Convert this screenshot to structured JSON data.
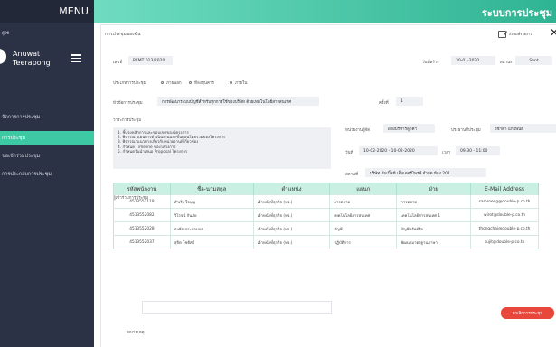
{
  "sidebar": {
    "menu_label": "MENU",
    "role": "ผู้ใช้",
    "user_first": "Anuwat",
    "user_last": "Teerapong",
    "items": [
      {
        "label": "จัดการการประชุม"
      },
      {
        "label": "การประชุม"
      },
      {
        "label": "ขอเข้าร่วมประชุม"
      },
      {
        "label": "การประกอบการประชุม"
      }
    ],
    "active_index": 1
  },
  "header": {
    "system_title": "ระบบการประชุม",
    "accent_color": "#2fb493",
    "sidebar_color": "#2b3245"
  },
  "card": {
    "title": "การประชุมของฉัน",
    "print_label": "สั่งพิมพ์รายงาน"
  },
  "form": {
    "doc_no_label": "เลขที่",
    "doc_no": "RFMT 013/2020",
    "created_label": "วันที่สร้าง",
    "created": "30-01-2020",
    "status_label": "สถานะ",
    "status": "Sent",
    "type_label": "ประเภทการประชุม",
    "type_options": [
      "ภายนอก",
      "ที่ลงทุนคาร",
      "ภายใน"
    ],
    "topic_label": "หัวข้อการประชุม",
    "topic": "การพัฒนาระบบบัญชีสำหรับทุกการใช้ของบริษัท ด้วยเทคโนโลยีสารสนเทศ",
    "round_label": "ครั้งที่",
    "round": "1",
    "agenda_label": "วาระการประชุม",
    "agenda": [
      "1. ชี้แจงหลักการและขอบเขตของโครงการ",
      "2. พิจารณาแผนการดำเนินงานและขั้นตอนโดยรวมของโครงการ",
      "3. พิจารณาแนวทางเกี่ยวกับหน่วยงานที่เกี่ยวข้อง",
      "4. กำหนด Timeline ของโครงการ",
      "5. กำหนดวันนำเสนอ Proposal โครงการ"
    ],
    "unit_label": "หน่วยงานผู้จัด",
    "unit": "ฝ่ายบริหารลูกค้า",
    "chair_label": "ประธานที่ประชุม",
    "chair": "วิชาดา แก้วพันธ์",
    "date_label": "วันที่",
    "date": "10-02-2020 - 10-02-2020",
    "time_label": "เวลา",
    "time": "09:30 - 11:00",
    "place_label": "สถานที่",
    "place": "บริษัท ดับเบิ้ลพี เอ็นเตอร์ไพรส์ จำกัด ห้อง 201"
  },
  "attendees": {
    "section_label": "ผู้เข้าร่วมการประชุม",
    "headers": [
      "รหัสพนักงาน",
      "ชื่อ-นามสกุล",
      "ตำแหน่ง",
      "แผนก",
      "ฝ่าย",
      "E-Mail Address"
    ],
    "rows": [
      [
        "4513552118",
        "สำเริง ใจบุญ",
        "เจ้าหน้าที่ธุรกิจ (ทจ.)",
        "การตลาด",
        "การตลาด",
        "samroeng@double-p.co.th"
      ],
      [
        "4513552082",
        "วิโรจน์ กันภัย",
        "เจ้าหน้าที่ธุรกิจ (ทจ.)",
        "เทคโนโลยีสารสนเทศ",
        "เทคโนโลยีสารสนเทศ 1",
        "wirot@double-p.co.th"
      ],
      [
        "4513552028",
        "ธงชัย ประกอบผล",
        "เจ้าหน้าที่ธุรกิจ (ทจ.)",
        "บัญชี",
        "บัญชีทรัพย์สิน",
        "thongchai@double-p.co.th"
      ],
      [
        "4513552037",
        "สุจิต โชติศรี",
        "เจ้าหน้าที่ธุรกิจ (ทจ.)",
        "ปฏิบัติการ",
        "พัฒนามาตรฐานภาษา",
        "sujit@double-p.co.th"
      ]
    ]
  },
  "footer": {
    "note_label": "หมายเหตุ",
    "note_value": "",
    "cancel_label": "ยกเลิกการประชุม",
    "cancel_color": "#e8473b"
  }
}
